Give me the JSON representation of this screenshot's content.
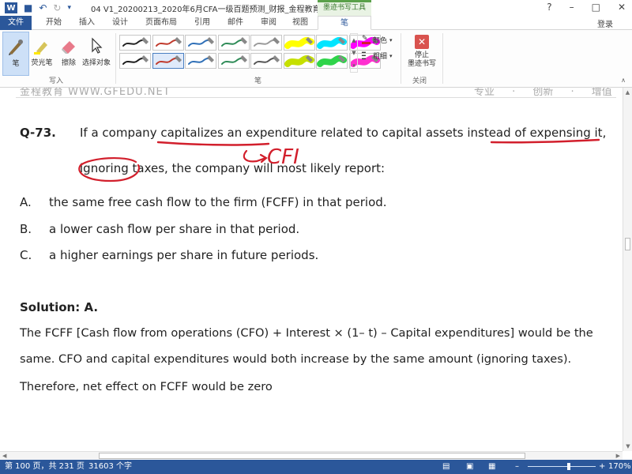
{
  "app": {
    "logo": "W",
    "title": "04 V1_20200213_2020年6月CFA一级百题预测_财报_金程教育...",
    "context_tool": "墨迹书写工具",
    "login": "登录",
    "window_buttons": [
      "?",
      "–",
      "□",
      "✕"
    ]
  },
  "tabs": [
    "文件",
    "开始",
    "插入",
    "设计",
    "页面布局",
    "引用",
    "邮件",
    "审阅",
    "视图",
    "笔"
  ],
  "ribbon": {
    "write_group": {
      "label": "写入",
      "buttons": [
        "笔",
        "荧光笔",
        "擦除",
        "选择对象"
      ]
    },
    "pens_group": {
      "label": "笔",
      "pen_colors": [
        "#222222",
        "#c0392b",
        "#2e6fb7",
        "#2e8b57",
        "#9a9a9a",
        "#ffff00",
        "#00e5ff",
        "#ff00ff",
        "#1a1a1a",
        "#c0392b",
        "#2e6fb7",
        "#2e8b57",
        "#555555",
        "#c6e000",
        "#2fd44a",
        "#ff2fd0"
      ],
      "color_label": "颜色",
      "thickness_label": "粗细"
    },
    "close_group": {
      "label": "关闭",
      "stop_label_1": "停止",
      "stop_label_2": "墨迹书写",
      "stop_icon": "✕"
    }
  },
  "document": {
    "faded_header": "金程教育 WWW.GFEDU.NET",
    "faded_right": "专业 · 创新 · 增值",
    "question_number": "Q-73.",
    "question_line1": "If a company capitalizes an expenditure related to capital assets instead of expensing it,",
    "question_line2": "ignoring taxes, the company will most likely report:",
    "options": [
      {
        "letter": "A.",
        "text": "the same free cash flow to the firm (FCFF) in that period."
      },
      {
        "letter": "B.",
        "text": "a lower cash flow per share in that period."
      },
      {
        "letter": "C.",
        "text": "a higher earnings per share in future periods."
      }
    ],
    "solution_title": "Solution: A.",
    "solution_lines": [
      "The FCFF [Cash flow from operations (CFO) + Interest × (1– t) – Capital expenditures] would be the",
      "same. CFO and capital expenditures would both increase by the same amount (ignoring taxes).",
      "Therefore, net effect on FCFF would be zero"
    ],
    "ink_annotation": "CFI",
    "ink_color": "#d21f2c"
  },
  "status": {
    "page": "第 100 页，共 231 页",
    "words": "31603 个字",
    "zoom": "170%",
    "zoom_fraction": 0.6
  }
}
